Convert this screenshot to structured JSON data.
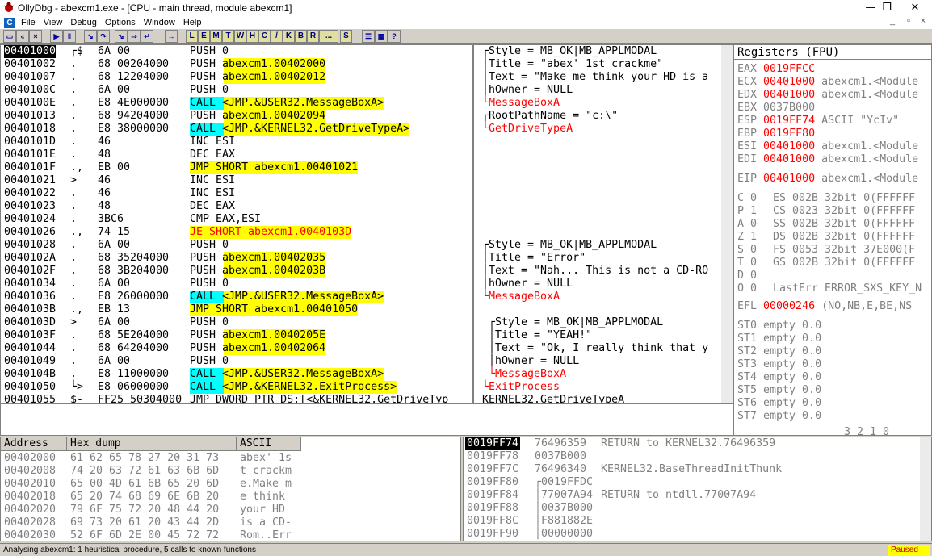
{
  "window": {
    "title": "OllyDbg - abexcm1.exe - [CPU - main thread, module abexcm1]",
    "min": "—",
    "max": "❐",
    "close": "✕"
  },
  "menu": {
    "items": [
      "File",
      "View",
      "Debug",
      "Options",
      "Window",
      "Help"
    ],
    "icon": "C",
    "ctl_min": "_",
    "ctl_max": "▫",
    "ctl_close": "×"
  },
  "toolbar": {
    "letters": [
      "L",
      "E",
      "M",
      "T",
      "W",
      "H",
      "C",
      "/",
      "K",
      "B",
      "R",
      "...",
      "S"
    ]
  },
  "disasm": [
    {
      "a": "00401000",
      "t": "┌$",
      "h": "6A 00",
      "d": "PUSH 0",
      "hl": "",
      "c": "┌Style = MB_OK|MB_APPLMODAL"
    },
    {
      "a": "00401002",
      "t": ".",
      "h": "68 00204000",
      "d": "PUSH abexcm1.00402000",
      "hl": "",
      "c": "│Title = \"abex' 1st crackme\""
    },
    {
      "a": "00401007",
      "t": ".",
      "h": "68 12204000",
      "d": "PUSH abexcm1.00402012",
      "hl": "",
      "c": "│Text = \"Make me think your HD is a"
    },
    {
      "a": "0040100C",
      "t": ".",
      "h": "6A 00",
      "d": "PUSH 0",
      "hl": "",
      "c": "│hOwner = NULL"
    },
    {
      "a": "0040100E",
      "t": ".",
      "h": "E8 4E000000",
      "d": "CALL <JMP.&USER32.MessageBoxA>",
      "hl": "call",
      "c": "└MessageBoxA"
    },
    {
      "a": "00401013",
      "t": ".",
      "h": "68 94204000",
      "d": "PUSH abexcm1.00402094",
      "hl": "",
      "c": "┌RootPathName = \"c:\\\""
    },
    {
      "a": "00401018",
      "t": ".",
      "h": "E8 38000000",
      "d": "CALL <JMP.&KERNEL32.GetDriveTypeA>",
      "hl": "call",
      "c": "└GetDriveTypeA"
    },
    {
      "a": "0040101D",
      "t": ".",
      "h": "46",
      "d": "INC ESI",
      "hl": "",
      "c": ""
    },
    {
      "a": "0040101E",
      "t": ".",
      "h": "48",
      "d": "DEC EAX",
      "hl": "",
      "c": ""
    },
    {
      "a": "0040101F",
      "t": ".,",
      "h": "EB 00",
      "d": "JMP SHORT abexcm1.00401021",
      "hl": "jmp",
      "c": ""
    },
    {
      "a": "00401021",
      "t": ">",
      "h": "46",
      "d": "INC ESI",
      "hl": "",
      "c": ""
    },
    {
      "a": "00401022",
      "t": ".",
      "h": "46",
      "d": "INC ESI",
      "hl": "",
      "c": ""
    },
    {
      "a": "00401023",
      "t": ".",
      "h": "48",
      "d": "DEC EAX",
      "hl": "",
      "c": ""
    },
    {
      "a": "00401024",
      "t": ".",
      "h": "3BC6",
      "d": "CMP EAX,ESI",
      "hl": "",
      "c": ""
    },
    {
      "a": "00401026",
      "t": ".,",
      "h": "74 15",
      "d": "JE SHORT abexcm1.0040103D",
      "hl": "je",
      "c": ""
    },
    {
      "a": "00401028",
      "t": ".",
      "h": "6A 00",
      "d": "PUSH 0",
      "hl": "",
      "c": "┌Style = MB_OK|MB_APPLMODAL"
    },
    {
      "a": "0040102A",
      "t": ".",
      "h": "68 35204000",
      "d": "PUSH abexcm1.00402035",
      "hl": "",
      "c": "│Title = \"Error\""
    },
    {
      "a": "0040102F",
      "t": ".",
      "h": "68 3B204000",
      "d": "PUSH abexcm1.0040203B",
      "hl": "",
      "c": "│Text = \"Nah... This is not a CD-RO"
    },
    {
      "a": "00401034",
      "t": ".",
      "h": "6A 00",
      "d": "PUSH 0",
      "hl": "",
      "c": "│hOwner = NULL"
    },
    {
      "a": "00401036",
      "t": ".",
      "h": "E8 26000000",
      "d": "CALL <JMP.&USER32.MessageBoxA>",
      "hl": "call",
      "c": "└MessageBoxA"
    },
    {
      "a": "0040103B",
      "t": ".,",
      "h": "EB 13",
      "d": "JMP SHORT abexcm1.00401050",
      "hl": "jmp",
      "c": ""
    },
    {
      "a": "0040103D",
      "t": ">",
      "h": "6A 00",
      "d": "PUSH 0",
      "hl": "",
      "c": " ┌Style = MB_OK|MB_APPLMODAL"
    },
    {
      "a": "0040103F",
      "t": ".",
      "h": "68 5E204000",
      "d": "PUSH abexcm1.0040205E",
      "hl": "",
      "c": " │Title = \"YEAH!\""
    },
    {
      "a": "00401044",
      "t": ".",
      "h": "68 64204000",
      "d": "PUSH abexcm1.00402064",
      "hl": "",
      "c": " │Text = \"Ok, I really think that y"
    },
    {
      "a": "00401049",
      "t": ".",
      "h": "6A 00",
      "d": "PUSH 0",
      "hl": "",
      "c": " │hOwner = NULL"
    },
    {
      "a": "0040104B",
      "t": ".",
      "h": "E8 11000000",
      "d": "CALL <JMP.&USER32.MessageBoxA>",
      "hl": "call",
      "c": " └MessageBoxA"
    },
    {
      "a": "00401050",
      "t": "└>",
      "h": "E8 06000000",
      "d": "CALL <JMP.&KERNEL32.ExitProcess>",
      "hl": "call",
      "c": "└ExitProcess"
    },
    {
      "a": "00401055",
      "t": "$-",
      "h": "FF25 50304000",
      "d": "JMP DWORD PTR DS:[<&KERNEL32.GetDriveTyp",
      "hl": "",
      "c": "KERNEL32.GetDriveTypeA"
    }
  ],
  "registers": {
    "title": "Registers (FPU)",
    "gp": [
      {
        "n": "EAX",
        "v": "0019FFCC",
        "x": ""
      },
      {
        "n": "ECX",
        "v": "00401000",
        "x": "abexcm1.<Module"
      },
      {
        "n": "EDX",
        "v": "00401000",
        "x": "abexcm1.<Module"
      },
      {
        "n": "EBX",
        "v": "0037B000",
        "x": ""
      },
      {
        "n": "ESP",
        "v": "0019FF74",
        "x": "ASCII \"YcIv\""
      },
      {
        "n": "EBP",
        "v": "0019FF80",
        "x": ""
      },
      {
        "n": "ESI",
        "v": "00401000",
        "x": "abexcm1.<Module"
      },
      {
        "n": "EDI",
        "v": "00401000",
        "x": "abexcm1.<Module"
      }
    ],
    "eip": {
      "n": "EIP",
      "v": "00401000",
      "x": "abexcm1.<Module"
    },
    "flags": [
      {
        "f": "C 0",
        "s": "ES 002B 32bit 0(FFFFFF"
      },
      {
        "f": "P 1",
        "s": "CS 0023 32bit 0(FFFFFF"
      },
      {
        "f": "A 0",
        "s": "SS 002B 32bit 0(FFFFFF"
      },
      {
        "f": "Z 1",
        "s": "DS 002B 32bit 0(FFFFFF"
      },
      {
        "f": "S 0",
        "s": "FS 0053 32bit 37E000(F"
      },
      {
        "f": "T 0",
        "s": "GS 002B 32bit 0(FFFFFF"
      },
      {
        "f": "D 0",
        "s": ""
      },
      {
        "f": "O 0",
        "s": "LastErr ERROR_SXS_KEY_N"
      }
    ],
    "efl": {
      "n": "EFL",
      "v": "00000246",
      "x": "(NO,NB,E,BE,NS"
    },
    "fpu": [
      "ST0 empty 0.0",
      "ST1 empty 0.0",
      "ST2 empty 0.0",
      "ST3 empty 0.0",
      "ST4 empty 0.0",
      "ST5 empty 0.0",
      "ST6 empty 0.0",
      "ST7 empty 0.0"
    ],
    "fpu_footer": "3 2 1 0"
  },
  "dump": {
    "headers": [
      "Address",
      "Hex dump",
      "ASCII"
    ],
    "rows": [
      {
        "a": "00402000",
        "h": "61 62 65 78 27 20 31 73",
        "s": "abex' 1s"
      },
      {
        "a": "00402008",
        "h": "74 20 63 72 61 63 6B 6D",
        "s": "t crackm"
      },
      {
        "a": "00402010",
        "h": "65 00 4D 61 6B 65 20 6D",
        "s": "e.Make m"
      },
      {
        "a": "00402018",
        "h": "65 20 74 68 69 6E 6B 20",
        "s": "e think "
      },
      {
        "a": "00402020",
        "h": "79 6F 75 72 20 48 44 20",
        "s": "your HD "
      },
      {
        "a": "00402028",
        "h": "69 73 20 61 20 43 44 2D",
        "s": "is a CD-"
      },
      {
        "a": "00402030",
        "h": "52 6F 6D 2E 00 45 72 72",
        "s": "Rom..Err"
      }
    ]
  },
  "stack": [
    {
      "a": "0019FF74",
      "v": "76496359",
      "c": "RETURN to KERNEL32.76496359"
    },
    {
      "a": "0019FF78",
      "v": "0037B000",
      "c": ""
    },
    {
      "a": "0019FF7C",
      "v": "76496340",
      "c": "KERNEL32.BaseThreadInitThunk"
    },
    {
      "a": "0019FF80",
      "v": "┌0019FFDC",
      "c": ""
    },
    {
      "a": "0019FF84",
      "v": "│77007A94",
      "c": "RETURN to ntdll.77007A94"
    },
    {
      "a": "0019FF88",
      "v": "│0037B000",
      "c": ""
    },
    {
      "a": "0019FF8C",
      "v": "│F881882E",
      "c": ""
    },
    {
      "a": "0019FF90",
      "v": "│00000000",
      "c": ""
    }
  ],
  "status": {
    "text": "Analysing abexcm1: 1 heuristical procedure, 5 calls to known functions",
    "state": "Paused"
  }
}
